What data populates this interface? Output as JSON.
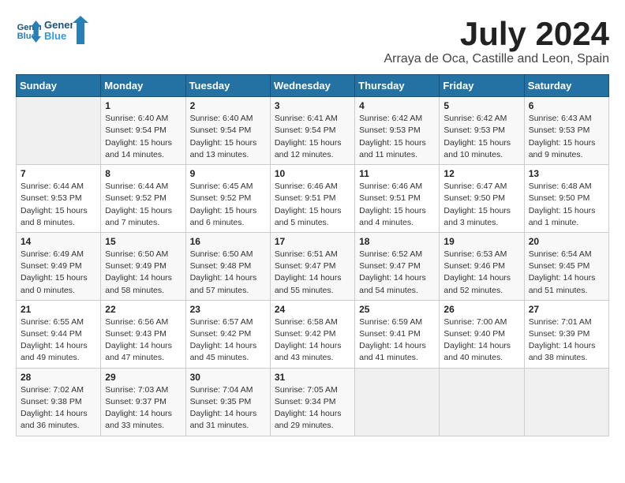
{
  "header": {
    "logo_line1": "General",
    "logo_line2": "Blue",
    "month": "July 2024",
    "location": "Arraya de Oca, Castille and Leon, Spain"
  },
  "weekdays": [
    "Sunday",
    "Monday",
    "Tuesday",
    "Wednesday",
    "Thursday",
    "Friday",
    "Saturday"
  ],
  "weeks": [
    [
      {
        "day": "",
        "info": ""
      },
      {
        "day": "1",
        "info": "Sunrise: 6:40 AM\nSunset: 9:54 PM\nDaylight: 15 hours\nand 14 minutes."
      },
      {
        "day": "2",
        "info": "Sunrise: 6:40 AM\nSunset: 9:54 PM\nDaylight: 15 hours\nand 13 minutes."
      },
      {
        "day": "3",
        "info": "Sunrise: 6:41 AM\nSunset: 9:54 PM\nDaylight: 15 hours\nand 12 minutes."
      },
      {
        "day": "4",
        "info": "Sunrise: 6:42 AM\nSunset: 9:53 PM\nDaylight: 15 hours\nand 11 minutes."
      },
      {
        "day": "5",
        "info": "Sunrise: 6:42 AM\nSunset: 9:53 PM\nDaylight: 15 hours\nand 10 minutes."
      },
      {
        "day": "6",
        "info": "Sunrise: 6:43 AM\nSunset: 9:53 PM\nDaylight: 15 hours\nand 9 minutes."
      }
    ],
    [
      {
        "day": "7",
        "info": "Sunrise: 6:44 AM\nSunset: 9:53 PM\nDaylight: 15 hours\nand 8 minutes."
      },
      {
        "day": "8",
        "info": "Sunrise: 6:44 AM\nSunset: 9:52 PM\nDaylight: 15 hours\nand 7 minutes."
      },
      {
        "day": "9",
        "info": "Sunrise: 6:45 AM\nSunset: 9:52 PM\nDaylight: 15 hours\nand 6 minutes."
      },
      {
        "day": "10",
        "info": "Sunrise: 6:46 AM\nSunset: 9:51 PM\nDaylight: 15 hours\nand 5 minutes."
      },
      {
        "day": "11",
        "info": "Sunrise: 6:46 AM\nSunset: 9:51 PM\nDaylight: 15 hours\nand 4 minutes."
      },
      {
        "day": "12",
        "info": "Sunrise: 6:47 AM\nSunset: 9:50 PM\nDaylight: 15 hours\nand 3 minutes."
      },
      {
        "day": "13",
        "info": "Sunrise: 6:48 AM\nSunset: 9:50 PM\nDaylight: 15 hours\nand 1 minute."
      }
    ],
    [
      {
        "day": "14",
        "info": "Sunrise: 6:49 AM\nSunset: 9:49 PM\nDaylight: 15 hours\nand 0 minutes."
      },
      {
        "day": "15",
        "info": "Sunrise: 6:50 AM\nSunset: 9:49 PM\nDaylight: 14 hours\nand 58 minutes."
      },
      {
        "day": "16",
        "info": "Sunrise: 6:50 AM\nSunset: 9:48 PM\nDaylight: 14 hours\nand 57 minutes."
      },
      {
        "day": "17",
        "info": "Sunrise: 6:51 AM\nSunset: 9:47 PM\nDaylight: 14 hours\nand 55 minutes."
      },
      {
        "day": "18",
        "info": "Sunrise: 6:52 AM\nSunset: 9:47 PM\nDaylight: 14 hours\nand 54 minutes."
      },
      {
        "day": "19",
        "info": "Sunrise: 6:53 AM\nSunset: 9:46 PM\nDaylight: 14 hours\nand 52 minutes."
      },
      {
        "day": "20",
        "info": "Sunrise: 6:54 AM\nSunset: 9:45 PM\nDaylight: 14 hours\nand 51 minutes."
      }
    ],
    [
      {
        "day": "21",
        "info": "Sunrise: 6:55 AM\nSunset: 9:44 PM\nDaylight: 14 hours\nand 49 minutes."
      },
      {
        "day": "22",
        "info": "Sunrise: 6:56 AM\nSunset: 9:43 PM\nDaylight: 14 hours\nand 47 minutes."
      },
      {
        "day": "23",
        "info": "Sunrise: 6:57 AM\nSunset: 9:42 PM\nDaylight: 14 hours\nand 45 minutes."
      },
      {
        "day": "24",
        "info": "Sunrise: 6:58 AM\nSunset: 9:42 PM\nDaylight: 14 hours\nand 43 minutes."
      },
      {
        "day": "25",
        "info": "Sunrise: 6:59 AM\nSunset: 9:41 PM\nDaylight: 14 hours\nand 41 minutes."
      },
      {
        "day": "26",
        "info": "Sunrise: 7:00 AM\nSunset: 9:40 PM\nDaylight: 14 hours\nand 40 minutes."
      },
      {
        "day": "27",
        "info": "Sunrise: 7:01 AM\nSunset: 9:39 PM\nDaylight: 14 hours\nand 38 minutes."
      }
    ],
    [
      {
        "day": "28",
        "info": "Sunrise: 7:02 AM\nSunset: 9:38 PM\nDaylight: 14 hours\nand 36 minutes."
      },
      {
        "day": "29",
        "info": "Sunrise: 7:03 AM\nSunset: 9:37 PM\nDaylight: 14 hours\nand 33 minutes."
      },
      {
        "day": "30",
        "info": "Sunrise: 7:04 AM\nSunset: 9:35 PM\nDaylight: 14 hours\nand 31 minutes."
      },
      {
        "day": "31",
        "info": "Sunrise: 7:05 AM\nSunset: 9:34 PM\nDaylight: 14 hours\nand 29 minutes."
      },
      {
        "day": "",
        "info": ""
      },
      {
        "day": "",
        "info": ""
      },
      {
        "day": "",
        "info": ""
      }
    ]
  ]
}
